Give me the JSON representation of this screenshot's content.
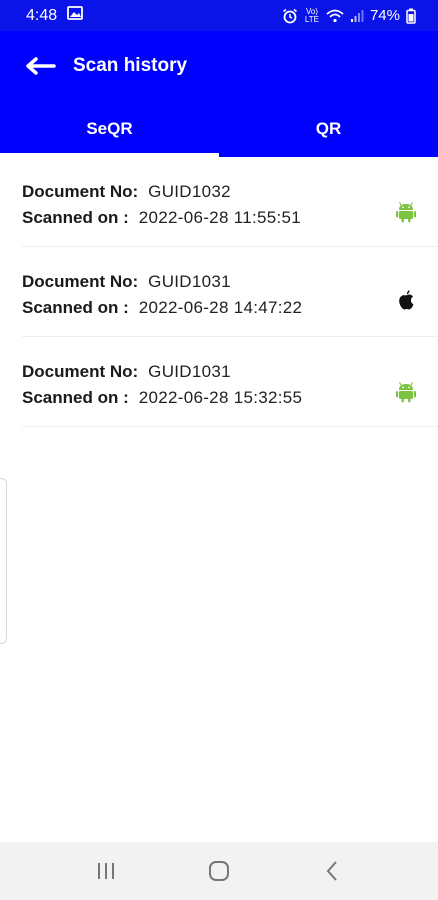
{
  "status_bar": {
    "time": "4:48",
    "battery": "74%",
    "network_label": "Vo) LTE"
  },
  "app_bar": {
    "title": "Scan history"
  },
  "tabs": [
    {
      "label": "SeQR",
      "active": true
    },
    {
      "label": "QR",
      "active": false
    }
  ],
  "history": [
    {
      "doc_label": "Document No:",
      "doc_value": "GUID1032",
      "scan_label": "Scanned on :",
      "scan_value": "2022-06-28 11:55:51",
      "platform": "android-icon"
    },
    {
      "doc_label": "Document No:",
      "doc_value": "GUID1031",
      "scan_label": "Scanned on :",
      "scan_value": "2022-06-28 14:47:22",
      "platform": "apple-icon"
    },
    {
      "doc_label": "Document No:",
      "doc_value": "GUID1031",
      "scan_label": "Scanned on :",
      "scan_value": "2022-06-28 15:32:55",
      "platform": "android-icon"
    }
  ],
  "colors": {
    "primary": "#0000ff",
    "status_bar": "#0a14e8",
    "android": "#7cc243",
    "apple": "#111111"
  }
}
